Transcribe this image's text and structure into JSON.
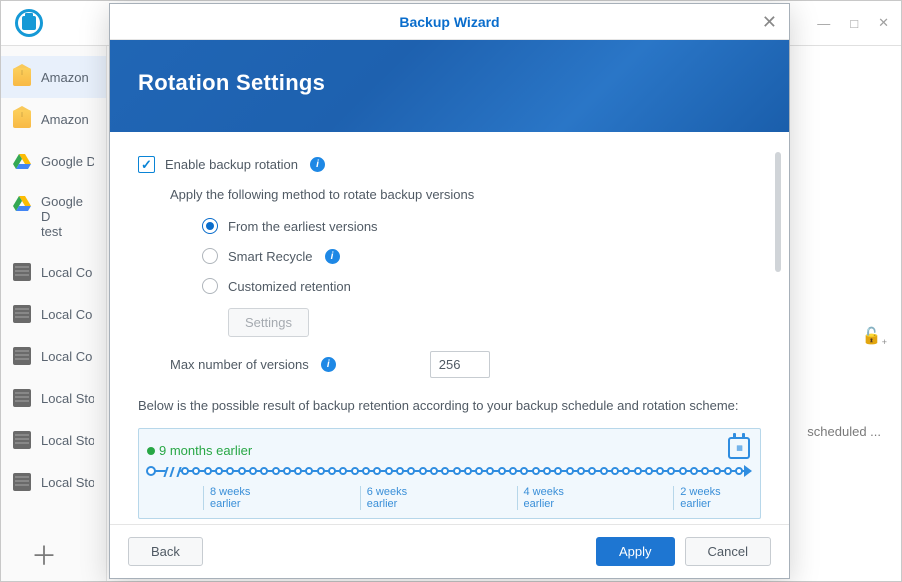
{
  "bg_window": {
    "controls": {
      "minimize": "—",
      "maximize": "□",
      "close": "✕"
    },
    "lock_glyph": "🔒",
    "scheduled_text": "scheduled ...",
    "add_glyph": "＋"
  },
  "sidebar": {
    "items": [
      {
        "label": "Amazon ",
        "icon": "amazon",
        "selected": true
      },
      {
        "label": "Amazon ",
        "icon": "amazon"
      },
      {
        "label": "Google D",
        "icon": "gdrive"
      },
      {
        "label": "Google D\ntest",
        "icon": "gdrive"
      },
      {
        "label": "Local Co",
        "icon": "local"
      },
      {
        "label": "Local Co",
        "icon": "local"
      },
      {
        "label": "Local Co",
        "icon": "local"
      },
      {
        "label": "Local Sto",
        "icon": "local"
      },
      {
        "label": "Local Sto",
        "icon": "local"
      },
      {
        "label": "Local Sto",
        "icon": "local"
      }
    ]
  },
  "modal": {
    "title": "Backup Wizard",
    "close_glyph": "✕",
    "banner_heading": "Rotation Settings",
    "enable_rotation_label": "Enable backup rotation",
    "apply_method_text": "Apply the following method to rotate backup versions",
    "radios": {
      "earliest": "From the earliest versions",
      "smart": "Smart Recycle",
      "custom": "Customized retention"
    },
    "settings_button": "Settings",
    "max_versions_label": "Max number of versions",
    "max_versions_value": "256",
    "desc_text": "Below is the possible result of backup retention according to your backup schedule and rotation scheme:",
    "timeline": {
      "label": "9 months earlier",
      "scale": [
        "8 weeks earlier",
        "6 weeks earlier",
        "4 weeks earlier",
        "2 weeks earlier"
      ]
    },
    "footer": {
      "back": "Back",
      "apply": "Apply",
      "cancel": "Cancel"
    }
  }
}
